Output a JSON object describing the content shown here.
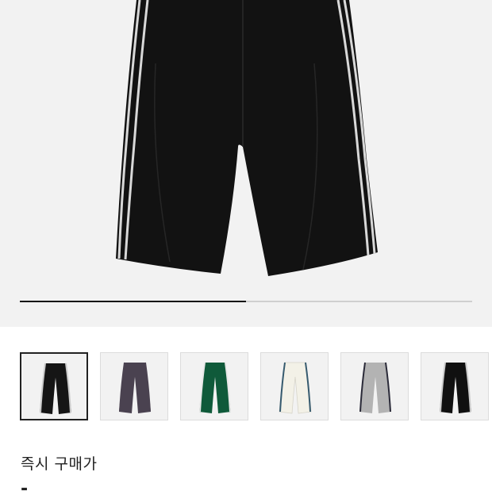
{
  "gallery": {
    "main_image": {
      "name": "black-track-pants-photo",
      "color": "#121212",
      "stripe": "#d8d8d8"
    },
    "progress_fraction": 0.5,
    "thumbnails": [
      {
        "name": "black-pants-thumbnail",
        "color": "#151515",
        "stripe": "#cccccc",
        "selected": true
      },
      {
        "name": "charcoal-purple-pants-thumbnail",
        "color": "#4a4250",
        "stripe": "#4a4250",
        "selected": false
      },
      {
        "name": "green-pants-thumbnail",
        "color": "#0f5a3a",
        "stripe": "#e8e8e8",
        "selected": false
      },
      {
        "name": "ivory-pants-thumbnail",
        "color": "#f3f1e7",
        "stripe": "#365a6e",
        "selected": false
      },
      {
        "name": "gray-pants-thumbnail",
        "color": "#b3b3b3",
        "stripe": "#2a2a38",
        "selected": false
      },
      {
        "name": "black-cargo-pants-thumbnail",
        "color": "#101010",
        "stripe": "#cccccc",
        "selected": false
      }
    ]
  },
  "price": {
    "label": "즉시 구매가",
    "value": "-"
  }
}
